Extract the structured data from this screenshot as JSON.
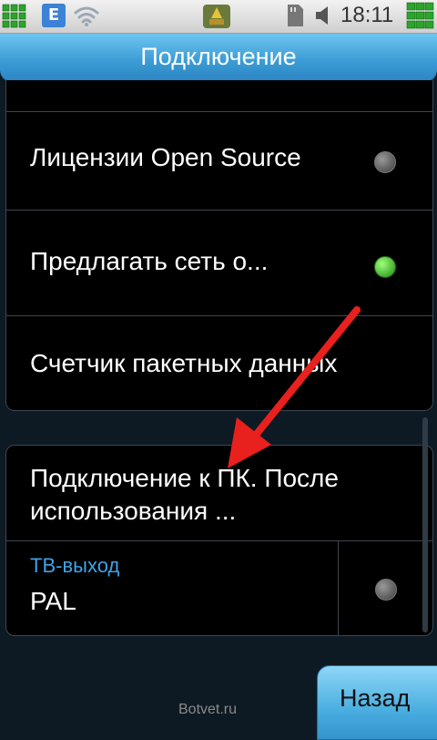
{
  "status_bar": {
    "network_badge": "E",
    "time": "18:11",
    "icons": [
      "grid-icon",
      "e-network-icon",
      "wifi-icon",
      "app-icon",
      "sd-card-icon",
      "volume-icon",
      "battery-icon"
    ]
  },
  "header": {
    "title": "Подключение"
  },
  "settings": {
    "items": [
      {
        "label": "Лицензии Open Source",
        "toggle": "off"
      },
      {
        "label": "Предлагать сеть о...",
        "toggle": "on"
      },
      {
        "label": "Счетчик пакетных данных"
      }
    ]
  },
  "pc_connection": {
    "line1": "Подключение к ПК. После",
    "line2": "использования ..."
  },
  "tv_out": {
    "label": "ТВ-выход",
    "value": "PAL",
    "toggle": "off"
  },
  "footer": {
    "back_label": "Назад"
  },
  "watermark": "Botvet.ru",
  "colors": {
    "accent": "#3a9ad4",
    "toggle_on": "#2fbf1a",
    "toggle_off": "#5a5a5a",
    "annotation_arrow": "#e8201e",
    "sublabel": "#3ea3e8"
  }
}
